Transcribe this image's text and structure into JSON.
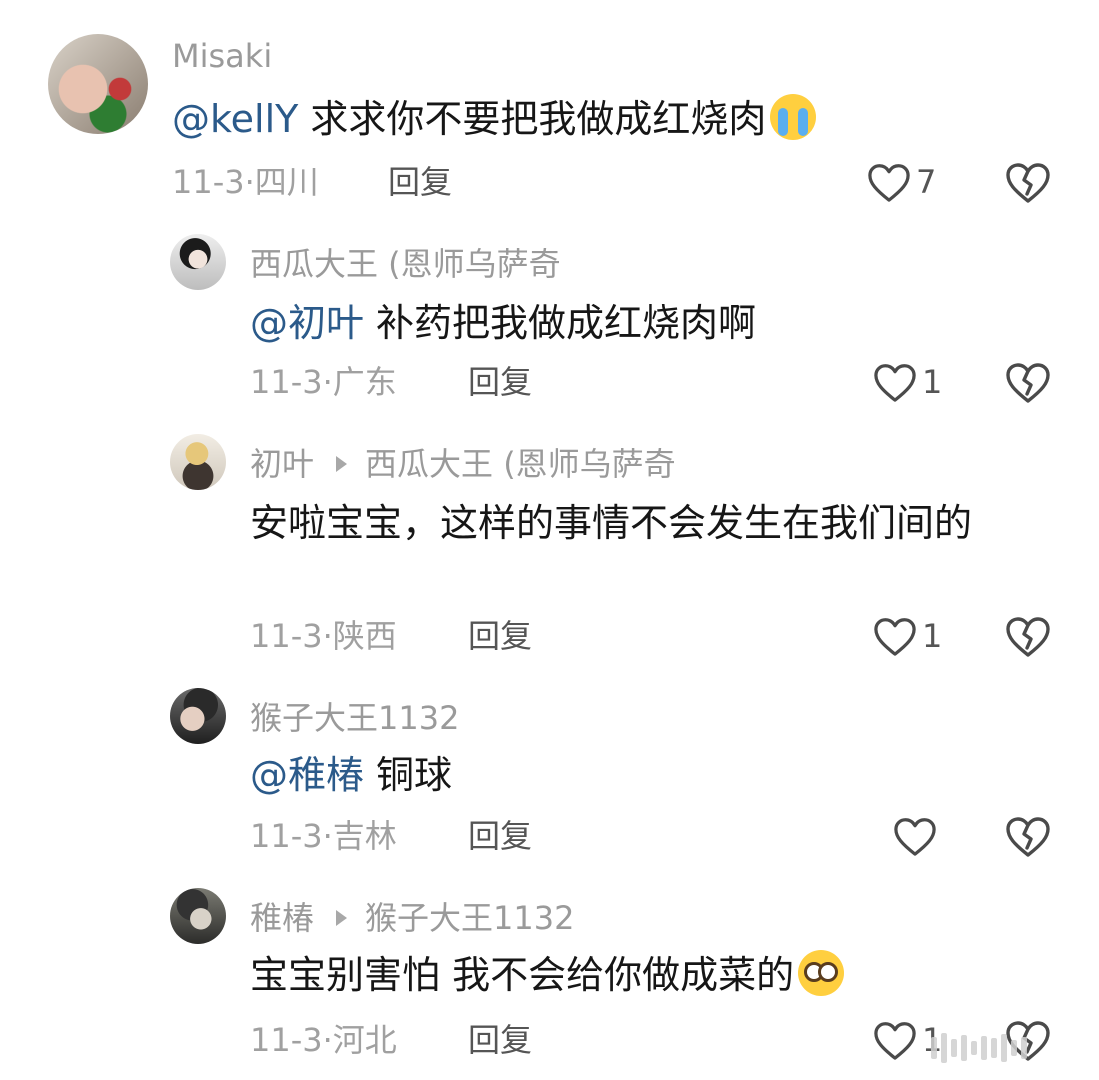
{
  "comments": [
    {
      "username": "Misaki",
      "reply_to": "",
      "mention": "@kellY",
      "text": "求求你不要把我做成红烧肉",
      "emoji": "loudly-crying-face-emoji",
      "date": "11-3",
      "location": "四川",
      "reply_label": "回复",
      "likes": "7"
    },
    {
      "username": "西瓜大王 (恩师乌萨奇",
      "reply_to": "",
      "mention": "@初叶",
      "text": "补药把我做成红烧肉啊",
      "date": "11-3",
      "location": "广东",
      "reply_label": "回复",
      "likes": "1"
    },
    {
      "username": "初叶",
      "reply_to": "西瓜大王 (恩师乌萨奇",
      "mention": "",
      "text": "安啦宝宝，这样的事情不会发生在我们间的",
      "date": "11-3",
      "location": "陕西",
      "reply_label": "回复",
      "likes": "1"
    },
    {
      "username": "猴子大王1132",
      "reply_to": "",
      "mention": "@稚椿",
      "text": "铜球",
      "date": "11-3",
      "location": "吉林",
      "reply_label": "回复",
      "likes": ""
    },
    {
      "username": "稚椿",
      "reply_to": "猴子大王1132",
      "mention": "",
      "text": "宝宝别害怕 我不会给你做成菜的",
      "emoji": "pleading-face-emoji",
      "date": "11-3",
      "location": "河北",
      "reply_label": "回复",
      "likes": "1"
    }
  ],
  "meta_separator": "·",
  "icons": {
    "like": "heart-outline-icon",
    "dislike": "broken-heart-icon"
  },
  "colors": {
    "mention": "#2b5a8a",
    "username": "#9a9a9a",
    "meta": "#a0a0a0",
    "text": "#161616"
  }
}
